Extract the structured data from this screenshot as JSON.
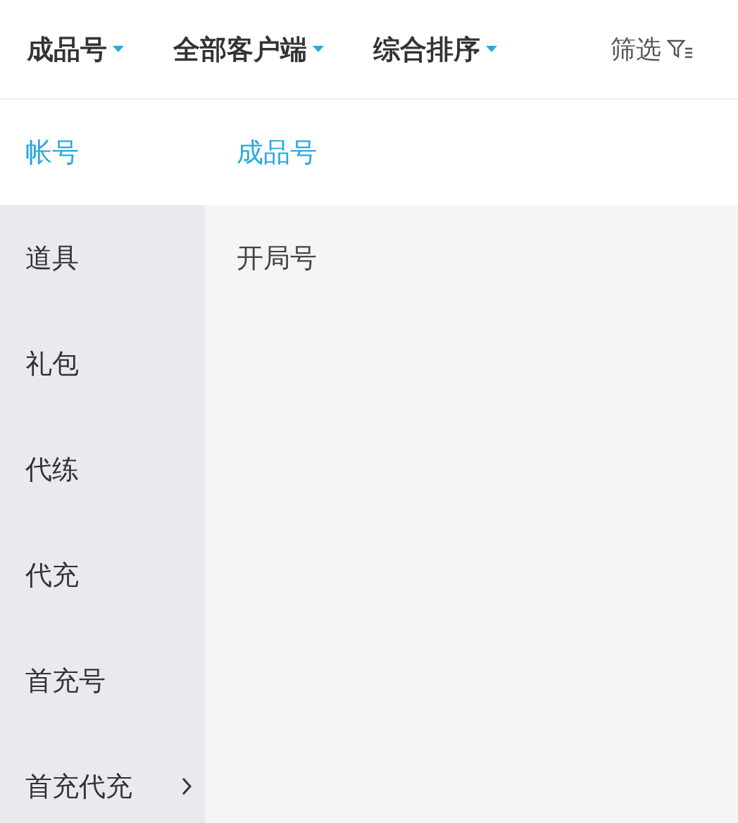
{
  "top_bar": {
    "dropdowns": [
      {
        "label": "成品号"
      },
      {
        "label": "全部客户端"
      },
      {
        "label": "综合排序"
      }
    ],
    "filter": {
      "label": "筛选"
    }
  },
  "categories": [
    {
      "label": "帐号",
      "selected": true,
      "has_children": false
    },
    {
      "label": "道具",
      "selected": false,
      "has_children": false
    },
    {
      "label": "礼包",
      "selected": false,
      "has_children": false
    },
    {
      "label": "代练",
      "selected": false,
      "has_children": false
    },
    {
      "label": "代充",
      "selected": false,
      "has_children": false
    },
    {
      "label": "首充号",
      "selected": false,
      "has_children": false
    },
    {
      "label": "首充代充",
      "selected": false,
      "has_children": true
    }
  ],
  "subcategories": [
    {
      "label": "成品号",
      "selected": true
    },
    {
      "label": "开局号",
      "selected": false
    }
  ]
}
